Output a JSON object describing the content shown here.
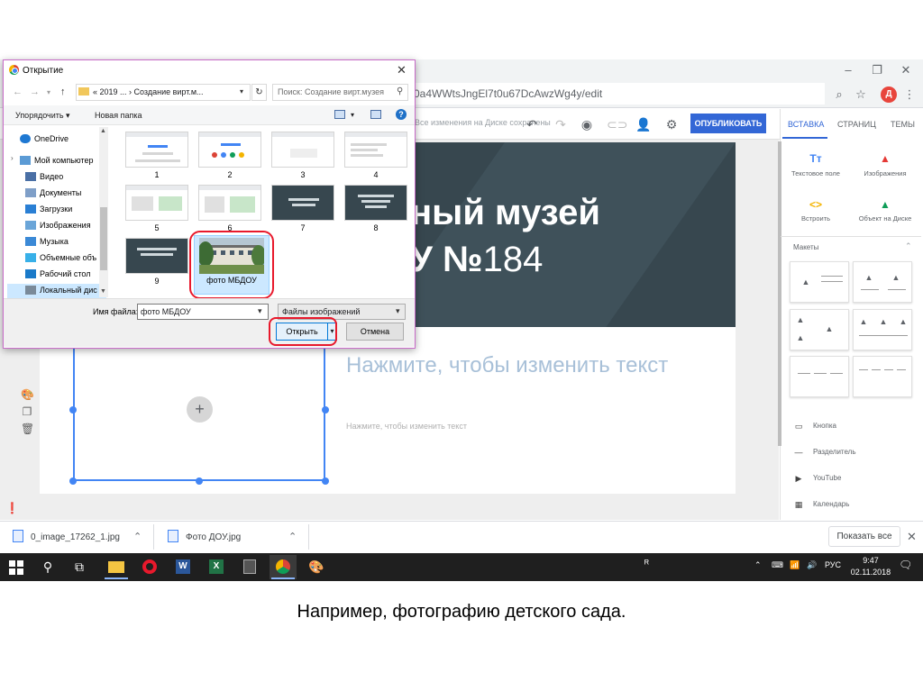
{
  "browser": {
    "url_fragment": "0a4WWtsJngEl7t0u67DcAwzWg4y/edit",
    "avatar_letter": "Д",
    "saved_status": "Все изменения на Диске сохранены",
    "publish_label": "ОПУБЛИКОВАТЬ"
  },
  "banner": {
    "line1": "ный музей",
    "line2_bold": "У №",
    "line2_num": "184"
  },
  "editor": {
    "heading_placeholder": "Нажмите, чтобы изменить текст",
    "body_placeholder": "Нажмите, чтобы изменить текст",
    "plus": "+"
  },
  "right_panel": {
    "tabs": [
      "ВСТАВКА",
      "СТРАНИЦ",
      "ТЕМЫ"
    ],
    "insert_items": [
      {
        "label": "Текстовое поле",
        "icon": "text-box-icon",
        "glyph": "Tт",
        "color": "#4285f4"
      },
      {
        "label": "Изображения",
        "icon": "image-icon",
        "glyph": "▲",
        "color": "#e53935"
      },
      {
        "label": "Встроить",
        "icon": "embed-icon",
        "glyph": "<>",
        "color": "#f4b400"
      },
      {
        "label": "Объект на Диске",
        "icon": "drive-icon",
        "glyph": "▲",
        "color": "#0f9d58"
      }
    ],
    "layouts_label": "Макеты",
    "components": [
      {
        "label": "Кнопка",
        "icon": "button-icon",
        "glyph": "▭"
      },
      {
        "label": "Разделитель",
        "icon": "divider-icon",
        "glyph": "—"
      },
      {
        "label": "YouTube",
        "icon": "youtube-icon",
        "glyph": "▶"
      },
      {
        "label": "Календарь",
        "icon": "calendar-icon",
        "glyph": "▦"
      }
    ]
  },
  "downloads": {
    "items": [
      "0_image_17262_1.jpg",
      "Фото ДОУ.jpg"
    ],
    "show_all": "Показать все"
  },
  "taskbar": {
    "lang": "РУС",
    "time": "9:47",
    "date": "02.11.2018"
  },
  "dialog": {
    "title": "Открытие",
    "path": "« 2019 ... › Создание вирт.м...",
    "search_placeholder": "Поиск: Создание вирт.музея",
    "organize": "Упорядочить ▾",
    "new_folder": "Новая папка",
    "help": "?",
    "tree": [
      {
        "label": "OneDrive",
        "icon": "onedrive-icon",
        "color": "#1e78d2"
      },
      {
        "label": "Мой компьютер",
        "icon": "computer-icon",
        "color": "#5b9bd5"
      },
      {
        "label": "Видео",
        "icon": "video-folder-icon",
        "color": "#4a6fa5"
      },
      {
        "label": "Документы",
        "icon": "documents-folder-icon",
        "color": "#7f9fc8"
      },
      {
        "label": "Загрузки",
        "icon": "downloads-folder-icon",
        "color": "#2a7fd4"
      },
      {
        "label": "Изображения",
        "icon": "pictures-folder-icon",
        "color": "#6aa5d8"
      },
      {
        "label": "Музыка",
        "icon": "music-folder-icon",
        "color": "#3b89d6"
      },
      {
        "label": "Объемные объ",
        "icon": "3d-objects-icon",
        "color": "#38b0e8"
      },
      {
        "label": "Рабочий стол",
        "icon": "desktop-folder-icon",
        "color": "#1a7ac9"
      },
      {
        "label": "Локальный дис",
        "icon": "local-disk-icon",
        "color": "#7a8a99"
      }
    ],
    "thumbs": [
      "1",
      "2",
      "3",
      "4",
      "5",
      "6",
      "7",
      "8",
      "9"
    ],
    "selected_file": "фото МБДОУ",
    "file_name_label": "Имя файла:",
    "file_name_value": "фото МБДОУ",
    "file_type": "Файлы изображений",
    "open_label": "Открыть",
    "cancel_label": "Отмена"
  },
  "caption": "Например, фотографию детского сада."
}
